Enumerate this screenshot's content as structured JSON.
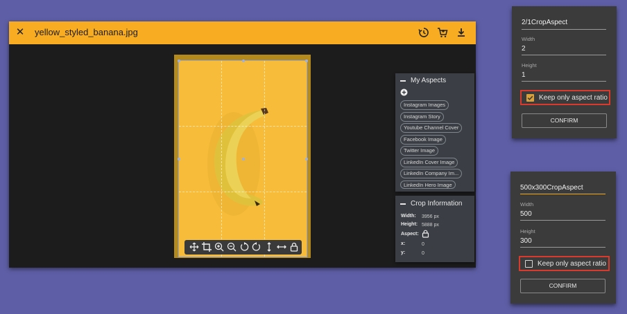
{
  "editor": {
    "filename": "yellow_styled_banana.jpg",
    "close_icon": "close-icon",
    "actions": [
      "history-icon",
      "cart-icon",
      "download-icon"
    ]
  },
  "toolbar_tools": [
    "move-icon",
    "crop-icon",
    "zoom-in-icon",
    "zoom-out-icon",
    "rotate-left-icon",
    "rotate-right-icon",
    "flip-vertical-icon",
    "flip-horizontal-icon",
    "lock-icon"
  ],
  "my_aspects": {
    "title": "My Aspects",
    "items": [
      "Instagram Images",
      "Instagram Story",
      "Youtube Channel Cover",
      "Facebook Image",
      "Twitter Image",
      "LinkedIn Cover Image",
      "LinkedIn Company Im...",
      "LinkedIn Hero Image"
    ]
  },
  "crop_info": {
    "title": "Crop Information",
    "width_label": "Width:",
    "width_value": "3956 px",
    "height_label": "Height:",
    "height_value": "5888 px",
    "aspect_label": "Aspect:",
    "x_label": "x:",
    "x_value": "0",
    "y_label": "y:",
    "y_value": "0"
  },
  "dialog1": {
    "name": "2/1CropAspect",
    "width_label": "Width",
    "width_value": "2",
    "height_label": "Height",
    "height_value": "1",
    "checkbox_label": "Keep only aspect ratio",
    "checked": true,
    "confirm": "CONFIRM"
  },
  "dialog2": {
    "name": "500x300CropAspect",
    "width_label": "Width",
    "width_value": "500",
    "height_label": "Height",
    "height_value": "300",
    "checkbox_label": "Keep only aspect ratio",
    "checked": false,
    "confirm": "CONFIRM"
  },
  "colors": {
    "accent": "#f7ac22",
    "panel": "#3b3f45",
    "highlight": "#d93a2b",
    "check": "#d9a13a"
  }
}
